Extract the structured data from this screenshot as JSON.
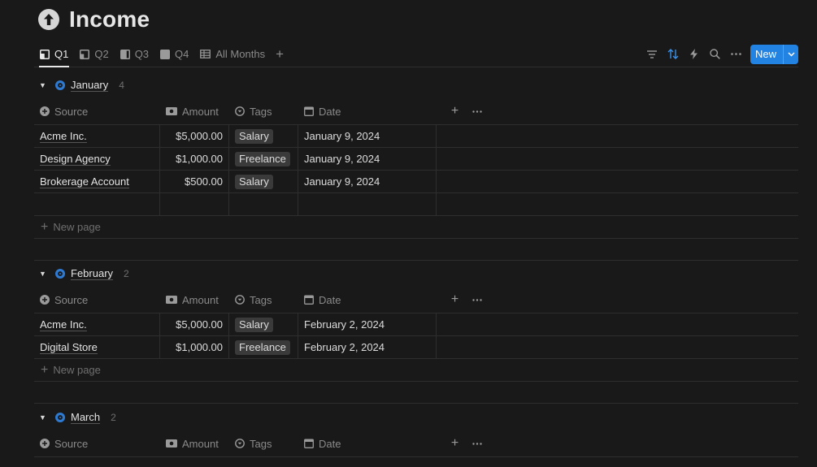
{
  "page": {
    "title": "Income",
    "icon": "arrow-up-circle-icon"
  },
  "tabs": [
    {
      "label": "Q1",
      "icon": "board-icon",
      "active": true
    },
    {
      "label": "Q2",
      "icon": "board-icon",
      "active": false
    },
    {
      "label": "Q3",
      "icon": "board-icon",
      "active": false
    },
    {
      "label": "Q4",
      "icon": "board-icon",
      "active": false
    },
    {
      "label": "All Months",
      "icon": "table-icon",
      "active": false
    }
  ],
  "toolbar": {
    "items": [
      "filter-icon",
      "sort-icon",
      "automation-icon",
      "search-icon",
      "more-icon"
    ],
    "new_label": "New",
    "accent": "#2383e2"
  },
  "columns": {
    "source": "Source",
    "amount": "Amount",
    "tags": "Tags",
    "date": "Date"
  },
  "new_page_label": "New page",
  "groups": [
    {
      "name": "January",
      "count": "4",
      "rows": [
        {
          "source": "Acme Inc.",
          "amount": "$5,000.00",
          "tag": "Salary",
          "date": "January 9, 2024"
        },
        {
          "source": "Design Agency",
          "amount": "$1,000.00",
          "tag": "Freelance",
          "date": "January 9, 2024"
        },
        {
          "source": "Brokerage Account",
          "amount": "$500.00",
          "tag": "Salary",
          "date": "January 9, 2024"
        },
        {
          "source": "",
          "amount": "",
          "tag": "",
          "date": ""
        }
      ]
    },
    {
      "name": "February",
      "count": "2",
      "rows": [
        {
          "source": "Acme Inc.",
          "amount": "$5,000.00",
          "tag": "Salary",
          "date": "February 2, 2024"
        },
        {
          "source": "Digital Store",
          "amount": "$1,000.00",
          "tag": "Freelance",
          "date": "February 2, 2024"
        }
      ]
    },
    {
      "name": "March",
      "count": "2",
      "rows": []
    }
  ]
}
